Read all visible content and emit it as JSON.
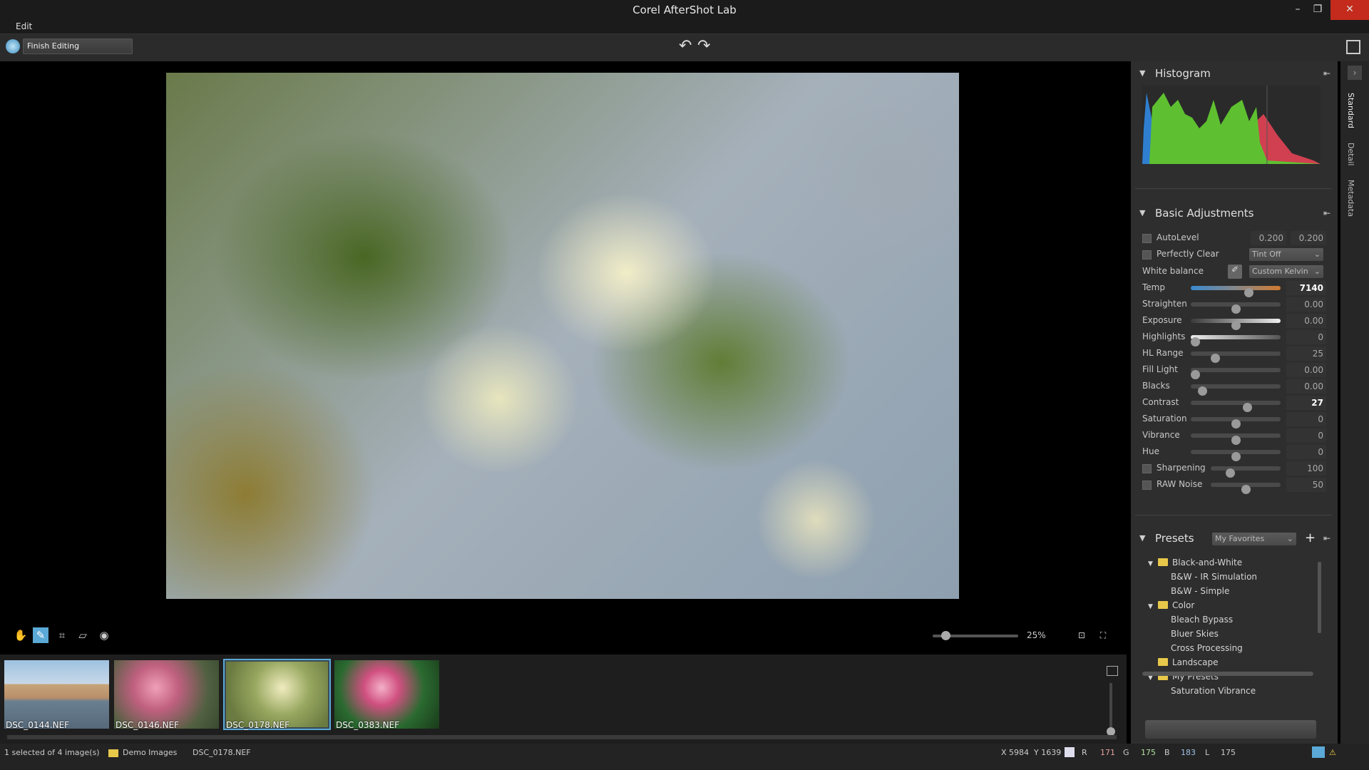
{
  "window": {
    "title": "Corel AfterShot Lab",
    "minimize": "–",
    "maximize": "❐",
    "close": "✕"
  },
  "menu": {
    "edit": "Edit"
  },
  "toolbar": {
    "finish_editing": "Finish Editing",
    "undo": "↶",
    "redo": "↷"
  },
  "viewer": {
    "zoom_percent": "25%",
    "zoom_level": 0.15
  },
  "filmstrip": [
    {
      "name": "DSC_0144.NEF",
      "selected": false
    },
    {
      "name": "DSC_0146.NEF",
      "selected": false
    },
    {
      "name": "DSC_0178.NEF",
      "selected": true
    },
    {
      "name": "DSC_0383.NEF",
      "selected": false
    }
  ],
  "status": {
    "selection": "1 selected of 4 image(s)",
    "folder": "Demo Images",
    "file": "DSC_0178.NEF",
    "coords": "X 5984  Y 1639",
    "r_label": "R",
    "r": "171",
    "g_label": "G",
    "g": "175",
    "b_label": "B",
    "b": "183",
    "l_label": "L",
    "l": "175"
  },
  "panel": {
    "tabs": [
      "Standard",
      "Detail",
      "Metadata"
    ],
    "histogram": {
      "title": "Histogram"
    },
    "basic": {
      "title": "Basic Adjustments",
      "autolevel": {
        "label": "AutoLevel",
        "v1": "0.200",
        "v2": "0.200"
      },
      "perfectly_clear": {
        "label": "Perfectly Clear",
        "option": "Tint Off"
      },
      "white_balance": {
        "label": "White balance",
        "option": "Custom Kelvin"
      },
      "sliders": [
        {
          "label": "Temp",
          "value": "7140",
          "pos": 0.64
        },
        {
          "label": "Straighten",
          "value": "0.00",
          "pos": 0.5
        },
        {
          "label": "Exposure",
          "value": "0.00",
          "pos": 0.5
        },
        {
          "label": "Highlights",
          "value": "0",
          "pos": 0.05
        },
        {
          "label": "HL Range",
          "value": "25",
          "pos": 0.27
        },
        {
          "label": "Fill Light",
          "value": "0.00",
          "pos": 0.05
        },
        {
          "label": "Blacks",
          "value": "0.00",
          "pos": 0.13
        },
        {
          "label": "Contrast",
          "value": "27",
          "pos": 0.63
        },
        {
          "label": "Saturation",
          "value": "0",
          "pos": 0.5
        },
        {
          "label": "Vibrance",
          "value": "0",
          "pos": 0.5
        },
        {
          "label": "Hue",
          "value": "0",
          "pos": 0.5
        },
        {
          "label": "Sharpening",
          "value": "100",
          "pos": 0.28,
          "checkbox": true
        },
        {
          "label": "RAW Noise",
          "value": "50",
          "pos": 0.5,
          "checkbox": true
        }
      ]
    },
    "presets": {
      "title": "Presets",
      "dropdown": "My Favorites",
      "add": "+",
      "items": [
        {
          "label": "Black-and-White",
          "folder": true,
          "expanded": true
        },
        {
          "label": "B&W - IR Simulation"
        },
        {
          "label": "B&W - Simple"
        },
        {
          "label": "Color",
          "folder": true,
          "expanded": true
        },
        {
          "label": "Bleach Bypass"
        },
        {
          "label": "Bluer Skies"
        },
        {
          "label": "Cross Processing"
        },
        {
          "label": "Landscape",
          "folder": true,
          "expanded": false
        },
        {
          "label": "My Presets",
          "folder": true,
          "expanded": true
        },
        {
          "label": "Saturation Vibrance"
        }
      ]
    }
  },
  "colors": {
    "accent": "#5aa9d6",
    "folder": "#e8c84a",
    "panel": "#2e2e2e"
  }
}
